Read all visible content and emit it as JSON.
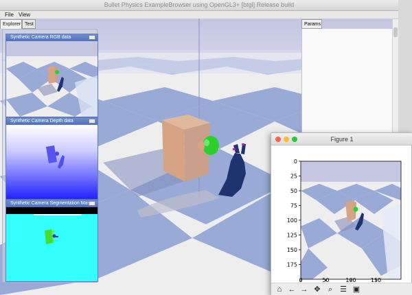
{
  "main_window": {
    "title": "Bullet Physics ExampleBrowser using OpenGL3+ [btgl] Release build",
    "menu": [
      {
        "label": "File"
      },
      {
        "label": "View"
      }
    ]
  },
  "explorer": {
    "tabs": [
      {
        "label": "Explorer",
        "active": true
      },
      {
        "label": "Test",
        "active": false
      }
    ],
    "cameras": [
      {
        "title": "Synthetic Camera RGB data"
      },
      {
        "title": "Synthetic Camera Depth data"
      },
      {
        "title": "Synthetic Camera Segmentation Mask"
      }
    ]
  },
  "params": {
    "tab_label": "Params"
  },
  "figure": {
    "window_title": "Figure 1",
    "traffic_light_colors": [
      "#fe5f57",
      "#febc2e",
      "#28c840"
    ],
    "yticks": [
      "0",
      "25",
      "50",
      "75",
      "100",
      "125",
      "150",
      "175"
    ],
    "xticks": [
      "0",
      "50",
      "100",
      "150"
    ],
    "toolbar": [
      {
        "icon": "home-icon"
      },
      {
        "icon": "back-arrow-icon"
      },
      {
        "icon": "forward-arrow-icon"
      },
      {
        "icon": "pan-icon"
      },
      {
        "icon": "zoom-icon"
      },
      {
        "icon": "configure-subplots-icon"
      },
      {
        "icon": "save-icon"
      }
    ]
  },
  "colors": {
    "floor_blue": "#9aaad6",
    "floor_white": "#eeeeee",
    "box": "#d7a88a",
    "sphere": "#2bd02b",
    "arm": "#1e3370",
    "segmentation_bg": "#33ffff",
    "segmentation_box": "#44dd33"
  }
}
